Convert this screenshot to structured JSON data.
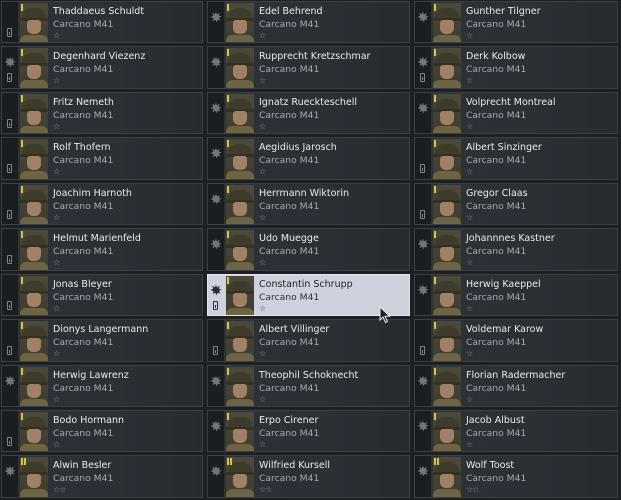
{
  "colors": {
    "card_bg": "#2c3237",
    "selected_bg": "#cfd2dd",
    "name_text": "#e9ecee",
    "weapon_text": "#a4abb0",
    "rank_badge": "#d8c34a"
  },
  "icons": {
    "class_icon": "explosion-icon",
    "ammo_icon": "ammo-icon",
    "star_icon": "star-icon",
    "cursor_icon": "mouse-cursor-icon"
  },
  "soldiers": [
    {
      "name": "Thaddaeus Schuldt",
      "weapon": "Carcano M41",
      "stars": "☆",
      "rank": 1,
      "class_icon": false,
      "ammo": true,
      "selected": false
    },
    {
      "name": "Edel Behrend",
      "weapon": "Carcano M41",
      "stars": "☆",
      "rank": 1,
      "class_icon": true,
      "ammo": false,
      "selected": false
    },
    {
      "name": "Gunther Tilgner",
      "weapon": "Carcano M41",
      "stars": "☆",
      "rank": 1,
      "class_icon": true,
      "ammo": false,
      "selected": false
    },
    {
      "name": "Degenhard Viezenz",
      "weapon": "Carcano M41",
      "stars": "☆",
      "rank": 1,
      "class_icon": true,
      "ammo": true,
      "selected": false
    },
    {
      "name": "Rupprecht Kretzschmar",
      "weapon": "Carcano M41",
      "stars": "☆",
      "rank": 1,
      "class_icon": true,
      "ammo": false,
      "selected": false
    },
    {
      "name": "Derk Kolbow",
      "weapon": "Carcano M41",
      "stars": "☆",
      "rank": 1,
      "class_icon": true,
      "ammo": true,
      "selected": false
    },
    {
      "name": "Fritz Nemeth",
      "weapon": "Carcano M41",
      "stars": "☆",
      "rank": 1,
      "class_icon": false,
      "ammo": true,
      "selected": false
    },
    {
      "name": "Ignatz Rueckteschell",
      "weapon": "Carcano M41",
      "stars": "☆",
      "rank": 1,
      "class_icon": true,
      "ammo": false,
      "selected": false
    },
    {
      "name": "Volprecht Montreal",
      "weapon": "Carcano M41",
      "stars": "☆",
      "rank": 1,
      "class_icon": true,
      "ammo": false,
      "selected": false
    },
    {
      "name": "Rolf Thofern",
      "weapon": "Carcano M41",
      "stars": "☆",
      "rank": 1,
      "class_icon": false,
      "ammo": true,
      "selected": false
    },
    {
      "name": "Aegidius Jarosch",
      "weapon": "Carcano M41",
      "stars": "☆",
      "rank": 1,
      "class_icon": true,
      "ammo": false,
      "selected": false
    },
    {
      "name": "Albert Sinzinger",
      "weapon": "Carcano M41",
      "stars": "☆",
      "rank": 1,
      "class_icon": false,
      "ammo": true,
      "selected": false
    },
    {
      "name": "Joachim Harnoth",
      "weapon": "Carcano M41",
      "stars": "☆",
      "rank": 1,
      "class_icon": false,
      "ammo": true,
      "selected": false
    },
    {
      "name": "Herrmann Wiktorin",
      "weapon": "Carcano M41",
      "stars": "☆",
      "rank": 1,
      "class_icon": true,
      "ammo": false,
      "selected": false
    },
    {
      "name": "Gregor Claas",
      "weapon": "Carcano M41",
      "stars": "☆",
      "rank": 1,
      "class_icon": false,
      "ammo": true,
      "selected": false
    },
    {
      "name": "Helmut Marienfeld",
      "weapon": "Carcano M41",
      "stars": "☆",
      "rank": 1,
      "class_icon": false,
      "ammo": true,
      "selected": false
    },
    {
      "name": "Udo Muegge",
      "weapon": "Carcano M41",
      "stars": "☆",
      "rank": 1,
      "class_icon": true,
      "ammo": false,
      "selected": false
    },
    {
      "name": "Johannnes Kastner",
      "weapon": "Carcano M41",
      "stars": "☆",
      "rank": 1,
      "class_icon": true,
      "ammo": false,
      "selected": false
    },
    {
      "name": "Jonas Bleyer",
      "weapon": "Carcano M41",
      "stars": "☆",
      "rank": 1,
      "class_icon": false,
      "ammo": true,
      "selected": false
    },
    {
      "name": "Constantin Schrupp",
      "weapon": "Carcano M41",
      "stars": "☆",
      "rank": 1,
      "class_icon": true,
      "ammo": true,
      "selected": true
    },
    {
      "name": "Herwig Kaeppel",
      "weapon": "Carcano M41",
      "stars": "☆",
      "rank": 1,
      "class_icon": true,
      "ammo": false,
      "selected": false
    },
    {
      "name": "Dionys Langermann",
      "weapon": "Carcano M41",
      "stars": "☆",
      "rank": 1,
      "class_icon": false,
      "ammo": true,
      "selected": false
    },
    {
      "name": "Albert Villinger",
      "weapon": "Carcano M41",
      "stars": "☆",
      "rank": 1,
      "class_icon": false,
      "ammo": true,
      "selected": false
    },
    {
      "name": "Voldemar Karow",
      "weapon": "Carcano M41",
      "stars": "☆",
      "rank": 1,
      "class_icon": false,
      "ammo": true,
      "selected": false
    },
    {
      "name": "Herwig Lawrenz",
      "weapon": "Carcano M41",
      "stars": "☆",
      "rank": 1,
      "class_icon": true,
      "ammo": false,
      "selected": false
    },
    {
      "name": "Theophil Schoknecht",
      "weapon": "Carcano M41",
      "stars": "☆",
      "rank": 1,
      "class_icon": true,
      "ammo": false,
      "selected": false
    },
    {
      "name": "Florian Radermacher",
      "weapon": "Carcano M41",
      "stars": "☆",
      "rank": 1,
      "class_icon": true,
      "ammo": false,
      "selected": false
    },
    {
      "name": "Bodo Hormann",
      "weapon": "Carcano M41",
      "stars": "☆",
      "rank": 1,
      "class_icon": false,
      "ammo": true,
      "selected": false
    },
    {
      "name": "Erpo Cirener",
      "weapon": "Carcano M41",
      "stars": "☆",
      "rank": 1,
      "class_icon": true,
      "ammo": false,
      "selected": false
    },
    {
      "name": "Jacob Albust",
      "weapon": "Carcano M41",
      "stars": "☆",
      "rank": 1,
      "class_icon": true,
      "ammo": false,
      "selected": false
    },
    {
      "name": "Alwin Besler",
      "weapon": "Carcano M41",
      "stars": "☆☆",
      "rank": 2,
      "class_icon": true,
      "ammo": false,
      "selected": false
    },
    {
      "name": "Wilfried Kursell",
      "weapon": "Carcano M41",
      "stars": "☆☆",
      "rank": 2,
      "class_icon": true,
      "ammo": false,
      "selected": false
    },
    {
      "name": "Wolf Toost",
      "weapon": "Carcano M41",
      "stars": "☆☆",
      "rank": 2,
      "class_icon": true,
      "ammo": false,
      "selected": false
    }
  ]
}
